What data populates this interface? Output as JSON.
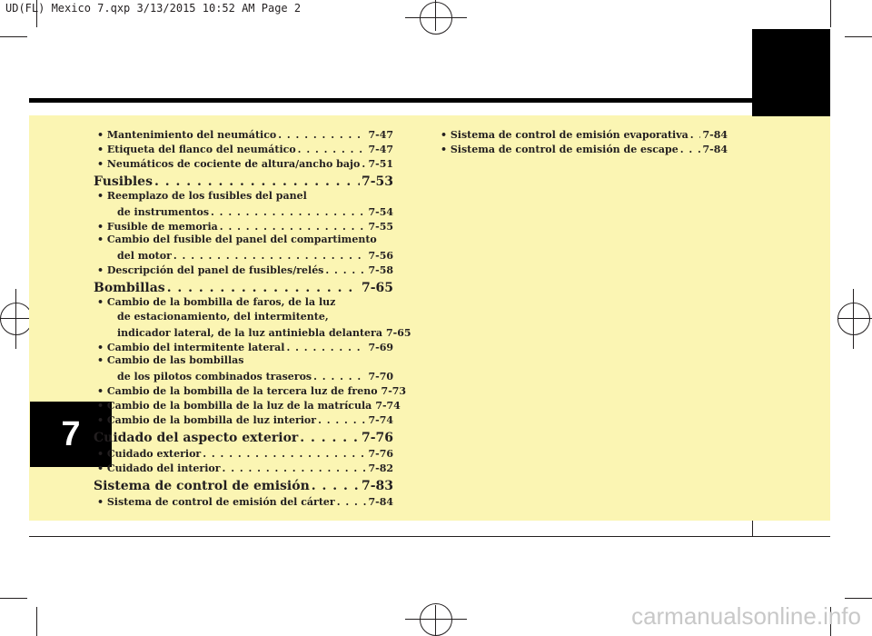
{
  "header": {
    "slug": "UD(FL) Mexico 7.qxp  3/13/2015  10:52 AM  Page 2"
  },
  "chapter": {
    "number": "7"
  },
  "toc": {
    "col1": {
      "items": [
        {
          "kind": "sub",
          "text": "• Mantenimiento del neumático",
          "page": "7-47"
        },
        {
          "kind": "sub",
          "text": "• Etiqueta del flanco del neumático",
          "page": "7-47"
        },
        {
          "kind": "sub",
          "text": "• Neumáticos de cociente de altura/ancho bajo",
          "page": "7-51"
        },
        {
          "kind": "head",
          "text": "Fusibles",
          "page": "7-53"
        },
        {
          "kind": "line-sub",
          "text": "• Reemplazo de los fusibles del panel"
        },
        {
          "kind": "cont",
          "text": "de instrumentos",
          "page": "7-54"
        },
        {
          "kind": "sub",
          "text": "• Fusible de memoria",
          "page": "7-55"
        },
        {
          "kind": "line-sub",
          "text": "• Cambio del fusible del panel del compartimento"
        },
        {
          "kind": "cont",
          "text": "del motor",
          "page": "7-56"
        },
        {
          "kind": "sub",
          "text": "• Descripción del panel de fusibles/relés",
          "page": "7-58"
        },
        {
          "kind": "head",
          "text": "Bombillas",
          "page": "7-65"
        },
        {
          "kind": "line-sub",
          "text": "• Cambio de la bombilla de faros, de la luz"
        },
        {
          "kind": "line-cont",
          "text": "de estacionamiento, del intermitente,"
        },
        {
          "kind": "cont",
          "text": "indicador lateral, de la luz antiniebla delantera",
          "page": "7-65"
        },
        {
          "kind": "sub",
          "text": "• Cambio del intermitente lateral",
          "page": "7-69"
        },
        {
          "kind": "line-sub",
          "text": "• Cambio de las bombillas"
        },
        {
          "kind": "cont",
          "text": "de los pilotos combinados traseros",
          "page": "7-70"
        },
        {
          "kind": "sub",
          "text": "• Cambio de la bombilla de la tercera luz de freno",
          "page": "7-73"
        },
        {
          "kind": "sub",
          "text": "• Cambio de la bombilla de la luz de la matrícula",
          "page": "7-74"
        },
        {
          "kind": "sub",
          "text": "• Cambio de la bombilla de luz interior",
          "page": "7-74"
        },
        {
          "kind": "head",
          "text": "Cuidado del aspecto exterior",
          "page": "7-76"
        },
        {
          "kind": "sub",
          "text": "• Cuidado exterior",
          "page": "7-76"
        },
        {
          "kind": "sub",
          "text": "• Cuidado del interior",
          "page": "7-82"
        },
        {
          "kind": "head",
          "text": "Sistema de control de emisión",
          "page": "7-83"
        },
        {
          "kind": "sub",
          "text": "• Sistema de control de emisión del cárter",
          "page": "7-84"
        }
      ]
    },
    "col2": {
      "items": [
        {
          "kind": "sub",
          "text": "• Sistema de control de emisión evaporativa",
          "page": "7-84"
        },
        {
          "kind": "sub",
          "text": "• Sistema de control de emisión de escape",
          "page": "7-84"
        }
      ]
    }
  },
  "watermark": "carmanualsonline.info",
  "colors": {
    "page_bg": "#fbf5b3",
    "tab": "#000000",
    "ink": "#231f20"
  }
}
